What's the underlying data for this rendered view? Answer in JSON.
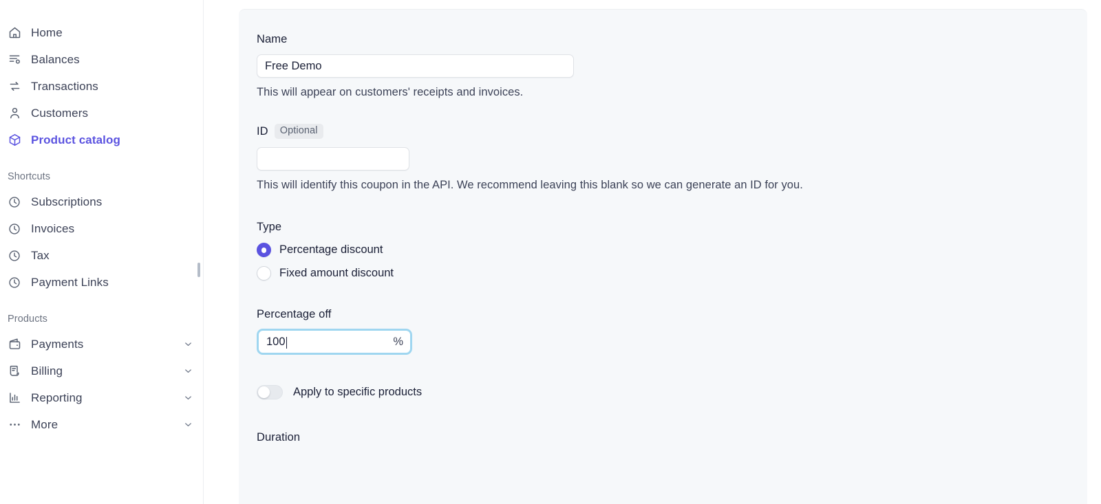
{
  "sidebar": {
    "primary_items": [
      {
        "label": "Home",
        "icon": "home-icon",
        "active": false
      },
      {
        "label": "Balances",
        "icon": "balances-icon",
        "active": false
      },
      {
        "label": "Transactions",
        "icon": "transactions-icon",
        "active": false
      },
      {
        "label": "Customers",
        "icon": "customers-icon",
        "active": false
      },
      {
        "label": "Product catalog",
        "icon": "product-catalog-icon",
        "active": true
      }
    ],
    "shortcuts_label": "Shortcuts",
    "shortcut_items": [
      {
        "label": "Subscriptions",
        "icon": "clock-icon"
      },
      {
        "label": "Invoices",
        "icon": "clock-icon"
      },
      {
        "label": "Tax",
        "icon": "clock-icon"
      },
      {
        "label": "Payment Links",
        "icon": "clock-icon"
      }
    ],
    "products_label": "Products",
    "product_items": [
      {
        "label": "Payments",
        "icon": "wallet-icon",
        "chevron": "chevron-down-icon"
      },
      {
        "label": "Billing",
        "icon": "billing-icon",
        "chevron": "chevron-down-icon"
      },
      {
        "label": "Reporting",
        "icon": "reporting-icon",
        "chevron": "chevron-down-icon"
      },
      {
        "label": "More",
        "icon": "more-icon",
        "chevron": "chevron-down-icon"
      }
    ]
  },
  "form": {
    "name": {
      "label": "Name",
      "value": "Free Demo",
      "placeholder": "",
      "helper": "This will appear on customers' receipts and invoices."
    },
    "id": {
      "label": "ID",
      "badge": "Optional",
      "value": "",
      "placeholder": "",
      "helper": "This will identify this coupon in the API. We recommend leaving this blank so we can generate an ID for you."
    },
    "type": {
      "label": "Type",
      "options": [
        {
          "label": "Percentage discount",
          "selected": true
        },
        {
          "label": "Fixed amount discount",
          "selected": false
        }
      ]
    },
    "percentage_off": {
      "label": "Percentage off",
      "value": "100",
      "suffix": "%",
      "focused": true
    },
    "apply_specific_products": {
      "label": "Apply to specific products",
      "enabled": false
    },
    "duration": {
      "label": "Duration"
    }
  },
  "colors": {
    "accent": "#5b53e0",
    "panel_bg": "#f6f8fa",
    "focus_ring": "#9fd6f0",
    "text_primary": "#1a1f36",
    "text_secondary": "#3c4257",
    "muted": "#6b7280"
  }
}
